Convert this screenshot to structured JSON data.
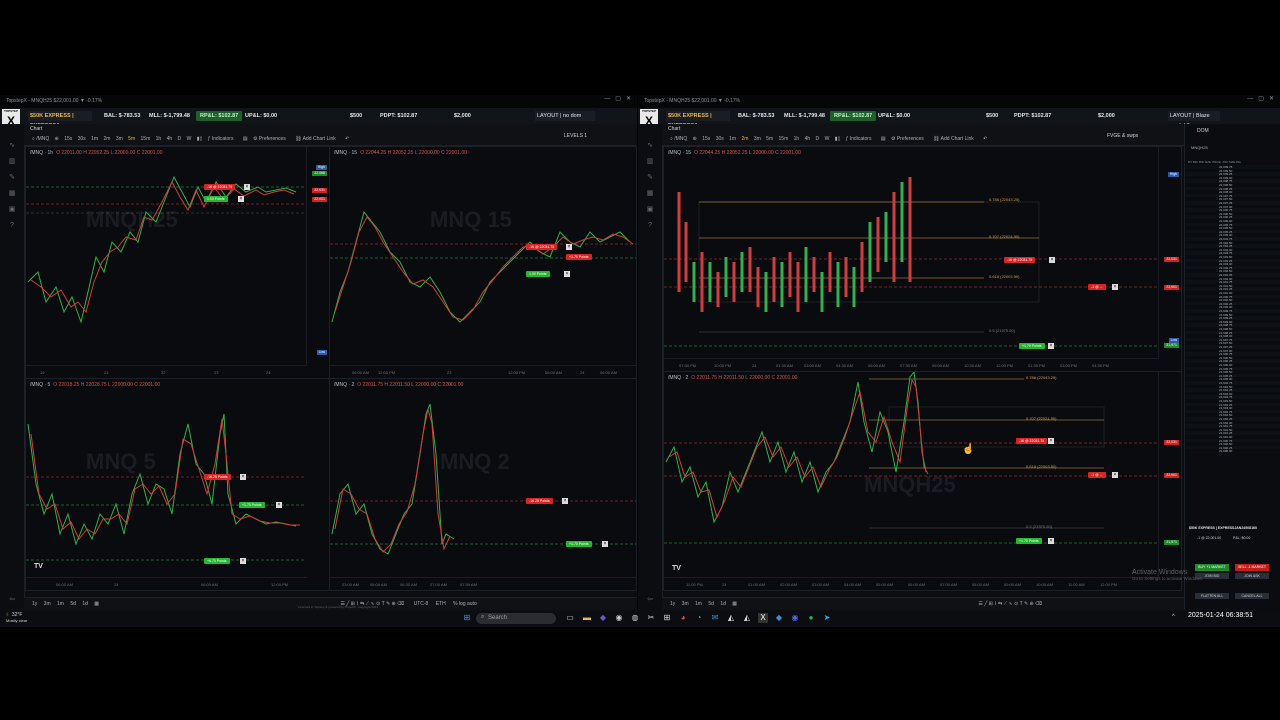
{
  "left_window": {
    "title": "TopstepX - MNQH25 $22,001.00 ▼ -0.17%",
    "account_name": "$50K EXPRESS | EXPRESSJ...",
    "bal": "BAL: $-783.53",
    "mll": "MLL: $-1,799.48",
    "rpl": "RP&L: $102.87",
    "upl": "UP&L: $0.00",
    "v500": "$500",
    "pdpt": "PDPT: $102.87",
    "v2000": "$2,000",
    "layout": "LAYOUT | no dom",
    "chart_tab": "Chart",
    "timeframes": [
      "15s",
      "30s",
      "1m",
      "2m",
      "3m",
      "5m",
      "15m",
      "1h",
      "4h",
      "D",
      "W"
    ],
    "indicators": "Indicators",
    "preferences": "Preferences",
    "add_chart_link": "Add Chart Link",
    "levels": "LEVELS 1",
    "panes": [
      {
        "label": "/MNQ · 1h",
        "ohlc": "O 22011.00  H 22052.25  L 22000.00  C 22001.00",
        "watermark": "MNQH25",
        "times": [
          "19",
          "21",
          "22",
          "23",
          "24"
        ]
      },
      {
        "label": "/MNQ · 15",
        "ohlc": "O 22044.25  H 22052.25  L 22000.00  C 22001.00",
        "watermark": "MNQ 15",
        "times": [
          "06:00 AM",
          "12:00 PM",
          "23",
          "12:00 PM",
          "06:00 AM",
          "24",
          "06:00 AM"
        ]
      },
      {
        "label": "/MNQ · 5",
        "ohlc": "O 22018.25  H 22028.75  L 22000.00  C 22001.00",
        "watermark": "MNQ 5",
        "times": [
          "06:00 AM",
          "24",
          "06:00 AM",
          "12:00 PM"
        ]
      },
      {
        "label": "/MNQ · 2",
        "ohlc": "O 22011.75  H 22011.50  L 22000.00  C 22001.00",
        "watermark": "MNQ 2",
        "times": [
          "03:00 AM",
          "06:00 AM",
          "06:30 AM",
          "07:00 AM",
          "07:30 AM"
        ]
      }
    ],
    "orders": {
      "stop_a": "-16 @ 22031.75",
      "target_a": "1.00 Points",
      "stop_b": "-16.25 Points",
      "target_b": "+1.70 Points",
      "target_c": "+6.70 Points"
    },
    "bottom_ranges": [
      "1y",
      "3m",
      "1m",
      "5d",
      "1d"
    ],
    "timezone": "UTC-8",
    "eth": "ETH",
    "footer": "Version 1.2.0",
    "powered": "Licensed to Topstep & powered by ProjectX. Copyright 2024"
  },
  "right_window": {
    "title": "TopstepX - MNQH25 $22,001.00 ▼ -0.17%",
    "account_name": "$50K EXPRESS | EXPRESSJ...",
    "bal": "BAL: $-783.53",
    "mll": "MLL: $-1,799.48",
    "rpl": "RP&L: $102.87",
    "upl": "UP&L: $0.00",
    "v500": "$500",
    "pdpt": "PDPT: $102.87",
    "v2000": "$2,000",
    "layout": "LAYOUT | Blaze model 3",
    "chart_tab": "Chart",
    "timeframes": [
      "15s",
      "30s",
      "1m",
      "2m",
      "3m",
      "5m",
      "15m",
      "1h",
      "4h",
      "D",
      "W"
    ],
    "indicators": "Indicators",
    "preferences": "Preferences",
    "add_chart_link": "Add Chart Link",
    "levels": "FVGE & swps",
    "panes": [
      {
        "label": "/MNQ · 15",
        "ohlc": "O 22044.25  H 22052.25  L 22000.00  C 22001.00",
        "fibs": [
          "0.786 (22043.25)",
          "0.707 (22024.50)",
          "0.618 (22003.50)",
          "0.5 (21975.50)"
        ],
        "times": [
          "07:30 PM",
          "10:00 PM",
          "24",
          "01:30 AM",
          "03:00 AM",
          "04:30 AM",
          "06:00 AM",
          "07:30 AM",
          "09:00 AM",
          "10:30 AM",
          "12:00 PM",
          "01:30 PM",
          "03:00 PM",
          "04:30 PM"
        ]
      },
      {
        "label": "/MNQ · 2",
        "ohlc": "O 22011.75  H 22011.50  L 22000.00  C 22001.00",
        "watermark": "MNQH25",
        "fibs": [
          "0.786 (22043.25)",
          "0.707 (22024.50)",
          "0.618 (22003.50)",
          "0.5 (21975.50)"
        ],
        "times": [
          "11:00 PM",
          "24",
          "01:00 AM",
          "02:00 AM",
          "03:00 AM",
          "04:00 AM",
          "05:00 AM",
          "06:00 AM",
          "07:00 AM",
          "08:00 AM",
          "09:00 AM",
          "10:00 AM",
          "11:00 AM",
          "12:00 PM"
        ]
      }
    ],
    "orders": {
      "stop": "-16 @ 22031.75",
      "target": "+1.70 Points",
      "sell_tag": "-1 @ ...",
      "stop_b": "-16 @ 22031.75"
    },
    "bottom_ranges": [
      "1y",
      "3m",
      "1m",
      "5d",
      "1d"
    ],
    "dom": {
      "title": "DOM",
      "contract": "MNQH25",
      "columns": [
        "MY BID",
        "BID SIZE",
        "PRICE",
        "ASK SIZE",
        "P&L"
      ],
      "prices": [
        "22,009.75",
        "22,009.50",
        "22,009.25",
        "22,009.00",
        "22,008.75",
        "22,008.50",
        "22,008.25",
        "22,008.00",
        "22,007.75",
        "22,007.50",
        "22,007.25",
        "22,007.00",
        "22,006.75",
        "22,006.50",
        "22,006.25",
        "22,006.00",
        "22,005.75",
        "22,005.50",
        "22,005.25",
        "22,005.00",
        "22,004.75",
        "22,004.50",
        "22,004.25",
        "22,004.00",
        "22,003.75",
        "22,003.50",
        "22,003.25",
        "22,003.00",
        "22,002.75",
        "22,002.50",
        "22,002.25",
        "22,002.00",
        "22,001.75",
        "22,001.50",
        "22,001.25",
        "22,001.00",
        "22,000.75",
        "22,000.50",
        "22,000.25",
        "22,000.00",
        "21,999.75",
        "21,999.50",
        "21,999.25",
        "21,999.00",
        "21,998.75",
        "21,998.50",
        "21,998.25",
        "21,998.00",
        "21,997.75",
        "21,997.50",
        "21,997.25",
        "21,997.00",
        "21,996.75",
        "21,996.50",
        "21,996.25",
        "21,996.00",
        "21,995.75",
        "21,995.50",
        "21,995.25",
        "21,995.00",
        "21,994.75",
        "21,994.50",
        "21,994.25",
        "21,994.00",
        "21,993.75",
        "21,993.50",
        "21,993.25",
        "21,993.00",
        "21,992.75",
        "21,992.50",
        "21,992.25",
        "21,992.00",
        "21,991.75",
        "21,991.50",
        "21,991.25",
        "21,991.00",
        "21,990.75",
        "21,990.50",
        "21,990.25",
        "21,990.00"
      ],
      "account": "$50K EXPRESS | EXPRESSJAN24908160",
      "position": "-1 @ 22,001.00",
      "pnl": "P&L: $0.00",
      "buy_market": "BUY +1 MARKET",
      "sell_market": "SELL -1 MARKET",
      "join_bid": "JOIN BID",
      "join_ask": "JOIN ASK",
      "flatten": "FLATTEN ALL",
      "cancel": "CANCEL ALL"
    },
    "activate": "Activate Windows",
    "activate_sub": "Go to Settings to activate Windows.",
    "footer": "Version 1.2.0"
  },
  "taskbar": {
    "weather_temp": "32°F",
    "weather_desc": "Mostly clear",
    "search": "Search",
    "datetime": "2025-01-24  06:38:51"
  }
}
